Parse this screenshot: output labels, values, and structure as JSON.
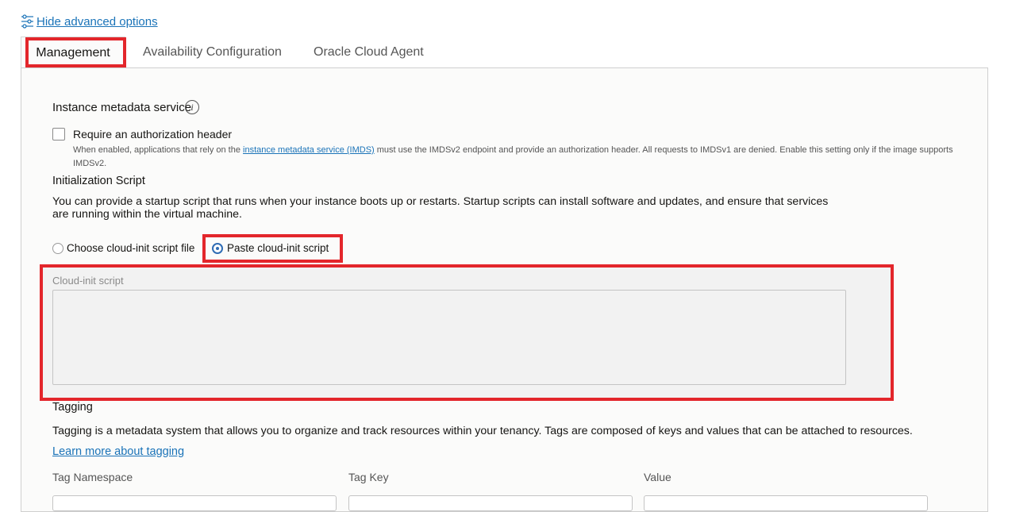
{
  "advanced_toggle": {
    "label": "Hide advanced options",
    "icon": "sliders-icon"
  },
  "tabs": [
    {
      "label": "Management",
      "active": true
    },
    {
      "label": "Availability Configuration",
      "active": false
    },
    {
      "label": "Oracle Cloud Agent",
      "active": false
    }
  ],
  "metadata_service": {
    "label": "Instance metadata service",
    "info_icon": "i",
    "checkbox_label": "Require an authorization header",
    "checked": false,
    "help_prefix": "When enabled, applications that rely on the ",
    "help_link": "instance metadata service (IMDS)",
    "help_suffix": " must use the IMDSv2 endpoint and provide an authorization header. All requests to IMDSv1 are denied. Enable this setting only if the image supports IMDSv2."
  },
  "init_script": {
    "heading": "Initialization Script",
    "description": "You can provide a startup script that runs when your instance boots up or restarts. Startup scripts can install software and updates, and ensure that services are running within the virtual machine.",
    "options": [
      {
        "label": "Choose cloud-init script file",
        "selected": false
      },
      {
        "label": "Paste cloud-init script",
        "selected": true
      }
    ],
    "script_label": "Cloud-init script",
    "script_value": ""
  },
  "tagging": {
    "heading": "Tagging",
    "description": "Tagging is a metadata system that allows you to organize and track resources within your tenancy. Tags are composed of keys and values that can be attached to resources.",
    "learn_more": "Learn more about tagging",
    "columns": [
      "Tag Namespace",
      "Tag Key",
      "Value"
    ]
  },
  "colors": {
    "accent": "#1a73b8",
    "highlight": "#e3262b",
    "radio": "#2f6cb4"
  }
}
